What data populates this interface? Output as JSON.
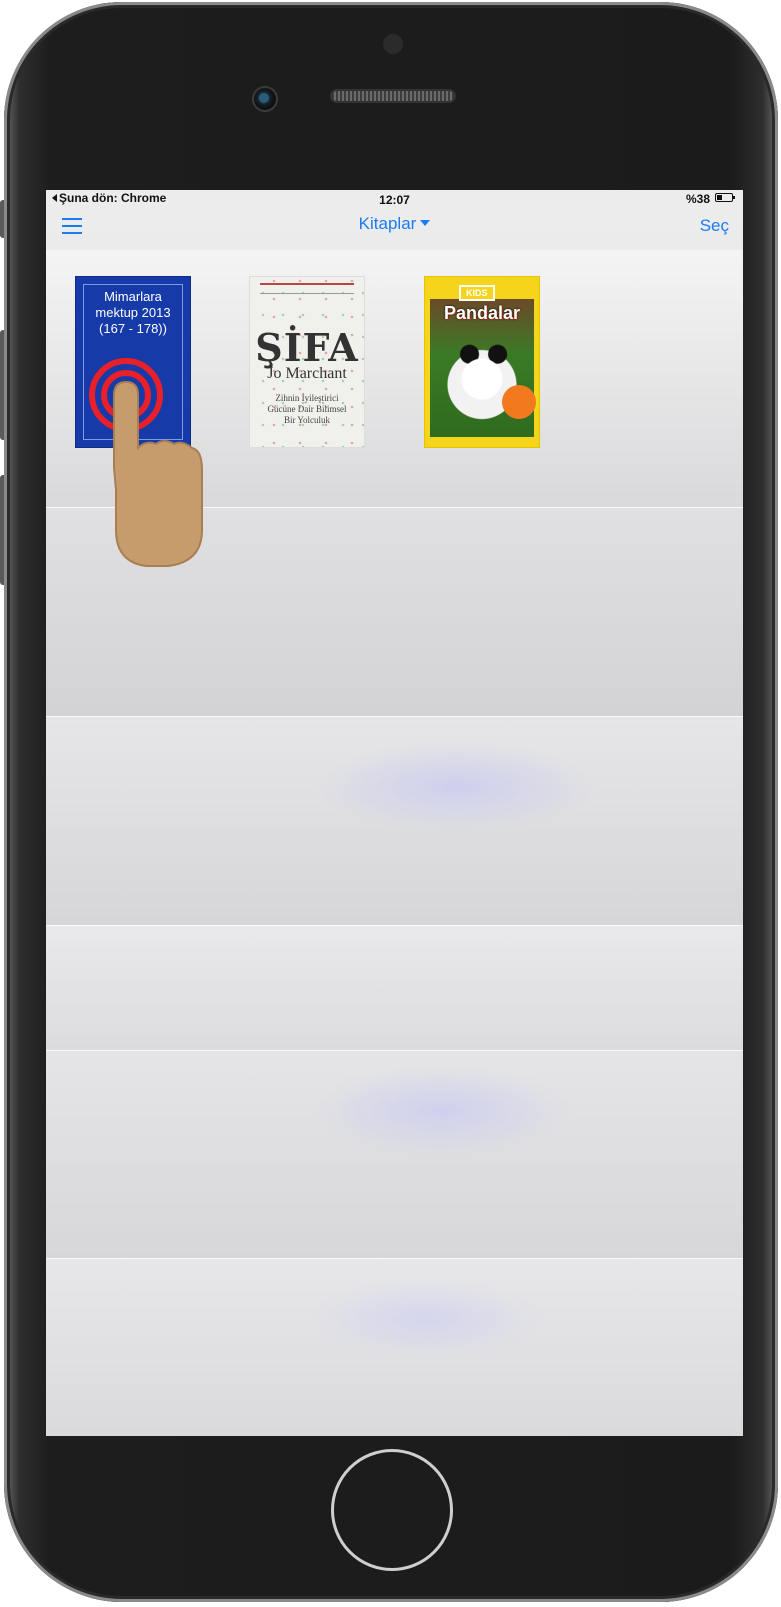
{
  "status_bar": {
    "back_app": "Şuna dön: Chrome",
    "time": "12:07",
    "battery_percent": "%38",
    "battery_level": 0.38
  },
  "nav_bar": {
    "menu_icon": "list-icon",
    "title": "Kitaplar",
    "title_icon": "caret-down-icon",
    "select_label": "Seç"
  },
  "books": [
    {
      "title": "Mimarlara\nmektup 2013\n(167 - 178))"
    },
    {
      "title": "ŞİFA",
      "author": "Jo Marchant",
      "subtitle": "Zihnin İyileştirici\nGücüne Dair Bilimsel\nBir Yolculuk"
    },
    {
      "title": "Pandalar",
      "series": "KIDS"
    }
  ],
  "gesture": {
    "type": "tap",
    "icon": "hand-pointer-icon"
  },
  "colors": {
    "accent": "#1a7cf2",
    "tap_ring": "#e8202a",
    "hand": "#c69c6d"
  }
}
